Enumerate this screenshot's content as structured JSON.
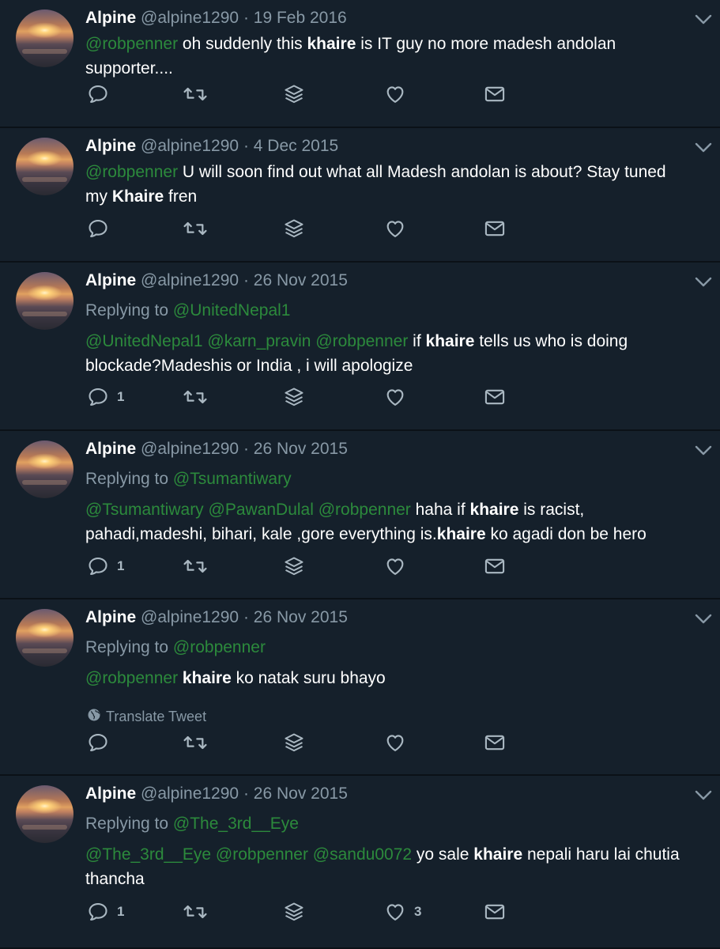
{
  "tweets": [
    {
      "name": "Alpine",
      "handle": "@alpine1290",
      "date": "19 Feb 2016",
      "replying_to": "",
      "segments": [
        {
          "t": "mention",
          "v": "@robpenner"
        },
        {
          "t": "text",
          "v": " oh suddenly this "
        },
        {
          "t": "bold",
          "v": "khaire"
        },
        {
          "t": "text",
          "v": " is IT guy no more madesh andolan supporter...."
        }
      ],
      "reply_count": "",
      "like_count": "",
      "translate": ""
    },
    {
      "name": "Alpine",
      "handle": "@alpine1290",
      "date": "4 Dec 2015",
      "replying_to": "",
      "segments": [
        {
          "t": "mention",
          "v": "@robpenner"
        },
        {
          "t": "text",
          "v": " U will soon find out  what all Madesh andolan is about? Stay tuned my "
        },
        {
          "t": "bold",
          "v": "Khaire"
        },
        {
          "t": "text",
          "v": " fren"
        }
      ],
      "reply_count": "",
      "like_count": "",
      "translate": ""
    },
    {
      "name": "Alpine",
      "handle": "@alpine1290",
      "date": "26 Nov 2015",
      "replying_to": "@UnitedNepal1",
      "segments": [
        {
          "t": "mention",
          "v": "@UnitedNepal1 @karn_pravin @robpenner"
        },
        {
          "t": "text",
          "v": "  if "
        },
        {
          "t": "bold",
          "v": "khaire"
        },
        {
          "t": "text",
          "v": " tells us who is doing blockade?Madeshis or India , i will apologize"
        }
      ],
      "reply_count": "1",
      "like_count": "",
      "translate": ""
    },
    {
      "name": "Alpine",
      "handle": "@alpine1290",
      "date": "26 Nov 2015",
      "replying_to": "@Tsumantiwary",
      "segments": [
        {
          "t": "mention",
          "v": "@Tsumantiwary @PawanDulal @robpenner"
        },
        {
          "t": "text",
          "v": " haha if "
        },
        {
          "t": "bold",
          "v": "khaire"
        },
        {
          "t": "text",
          "v": " is racist, pahadi,madeshi, bihari, kale ,gore everything is."
        },
        {
          "t": "bold",
          "v": "khaire"
        },
        {
          "t": "text",
          "v": " ko agadi don be hero"
        }
      ],
      "reply_count": "1",
      "like_count": "",
      "translate": ""
    },
    {
      "name": "Alpine",
      "handle": "@alpine1290",
      "date": "26 Nov 2015",
      "replying_to": "@robpenner",
      "segments": [
        {
          "t": "mention",
          "v": "@robpenner"
        },
        {
          "t": "text",
          "v": " "
        },
        {
          "t": "bold",
          "v": "khaire"
        },
        {
          "t": "text",
          "v": " ko natak suru bhayo"
        }
      ],
      "reply_count": "",
      "like_count": "",
      "translate": "Translate Tweet"
    },
    {
      "name": "Alpine",
      "handle": "@alpine1290",
      "date": "26 Nov 2015",
      "replying_to": "@The_3rd__Eye",
      "segments": [
        {
          "t": "mention",
          "v": "@The_3rd__Eye @robpenner @sandu0072"
        },
        {
          "t": "text",
          "v": " yo sale "
        },
        {
          "t": "bold",
          "v": "khaire"
        },
        {
          "t": "text",
          "v": " nepali haru lai chutia thancha"
        }
      ],
      "reply_count": "1",
      "like_count": "3",
      "translate": ""
    }
  ],
  "labels": {
    "replying_prefix": "Replying to ",
    "separator": " · "
  },
  "colors": {
    "background": "#15202b",
    "mention": "#2c8a3c",
    "muted": "#8899a6",
    "divider": "#0b1117"
  },
  "icons": [
    "reply-icon",
    "retweet-icon",
    "stack-icon",
    "like-icon",
    "mail-icon",
    "chevron-down-icon",
    "globe-icon"
  ]
}
